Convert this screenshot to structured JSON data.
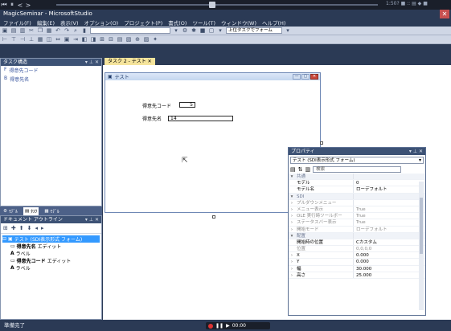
{
  "recorder": {
    "controls": [
      "⏮",
      "⏸",
      "<",
      ">"
    ],
    "time": "1:50? ■ :: ▤ ◆ ■",
    "status_text": "00:00"
  },
  "window": {
    "title": "MagicSeminar - MicrosoftStudio"
  },
  "menu": {
    "items": [
      "ファイル(F)",
      "編集(E)",
      "表示(V)",
      "オプション(O)",
      "プロジェクト(P)",
      "書式(O)",
      "ツール(T)",
      "ウィンドウ(W)",
      "ヘルプ(H)"
    ]
  },
  "toolbar": {
    "combo": "上位タスクでフォーム"
  },
  "task_panel": {
    "title": "タスク構造",
    "rows": [
      {
        "id": "F",
        "label": "得意先コード"
      },
      {
        "id": "B",
        "label": "得意先名"
      }
    ],
    "tabs": [
      "ﾓﾃﾞﾙ",
      "ﾀｽｸ",
      "ﾓﾃﾞﾙ"
    ]
  },
  "outline": {
    "title": "ドキュメント アウトライン",
    "root": "テスト (SDI表示形式 フォーム)",
    "children": [
      {
        "name": "得意先名",
        "type": "エディット"
      },
      {
        "name": "ラベル",
        "type": ""
      },
      {
        "name": "得意先コード",
        "type": "エディット"
      },
      {
        "name": "ラベル",
        "type": ""
      }
    ]
  },
  "document": {
    "tab_label": "タスク 2 - テスト",
    "form_caption": "テスト",
    "fields": [
      {
        "label": "得意先コード",
        "value": "5"
      },
      {
        "label": "得意先名",
        "value": "14"
      }
    ]
  },
  "properties": {
    "title": "プロパティ",
    "object": "テスト (SDI表示形式 フォーム)",
    "search_placeholder": "検索",
    "rows": [
      {
        "kind": "cat",
        "name": "共通",
        "value": ""
      },
      {
        "kind": "prop",
        "name": "モデル",
        "value": "0"
      },
      {
        "kind": "prop",
        "name": "モデル名",
        "value": "ローデフォルト"
      },
      {
        "kind": "cat",
        "name": "SDI",
        "value": ""
      },
      {
        "kind": "prop",
        "name": "プルダウンメニュー",
        "value": ""
      },
      {
        "kind": "prop",
        "name": "メニュー表示",
        "value": "True"
      },
      {
        "kind": "prop",
        "name": "OLE 実行時ツールボー",
        "value": "True"
      },
      {
        "kind": "prop",
        "name": "ステータスバー表示",
        "value": "True"
      },
      {
        "kind": "prop",
        "name": "開始モード",
        "value": "ローデフォルト"
      },
      {
        "kind": "cat",
        "name": "配置",
        "value": ""
      },
      {
        "kind": "prop",
        "name": "開始時の位置",
        "value": "Cカスタム"
      },
      {
        "kind": "prop",
        "name": "位置",
        "value": "0,0,0,0"
      },
      {
        "kind": "prop",
        "name": "X",
        "value": "0.000"
      },
      {
        "kind": "prop",
        "name": "Y",
        "value": "0.000"
      },
      {
        "kind": "prop",
        "name": "幅",
        "value": "30.000"
      },
      {
        "kind": "prop",
        "name": "高さ",
        "value": "25.000"
      }
    ]
  },
  "status": {
    "text": "準備完了"
  }
}
